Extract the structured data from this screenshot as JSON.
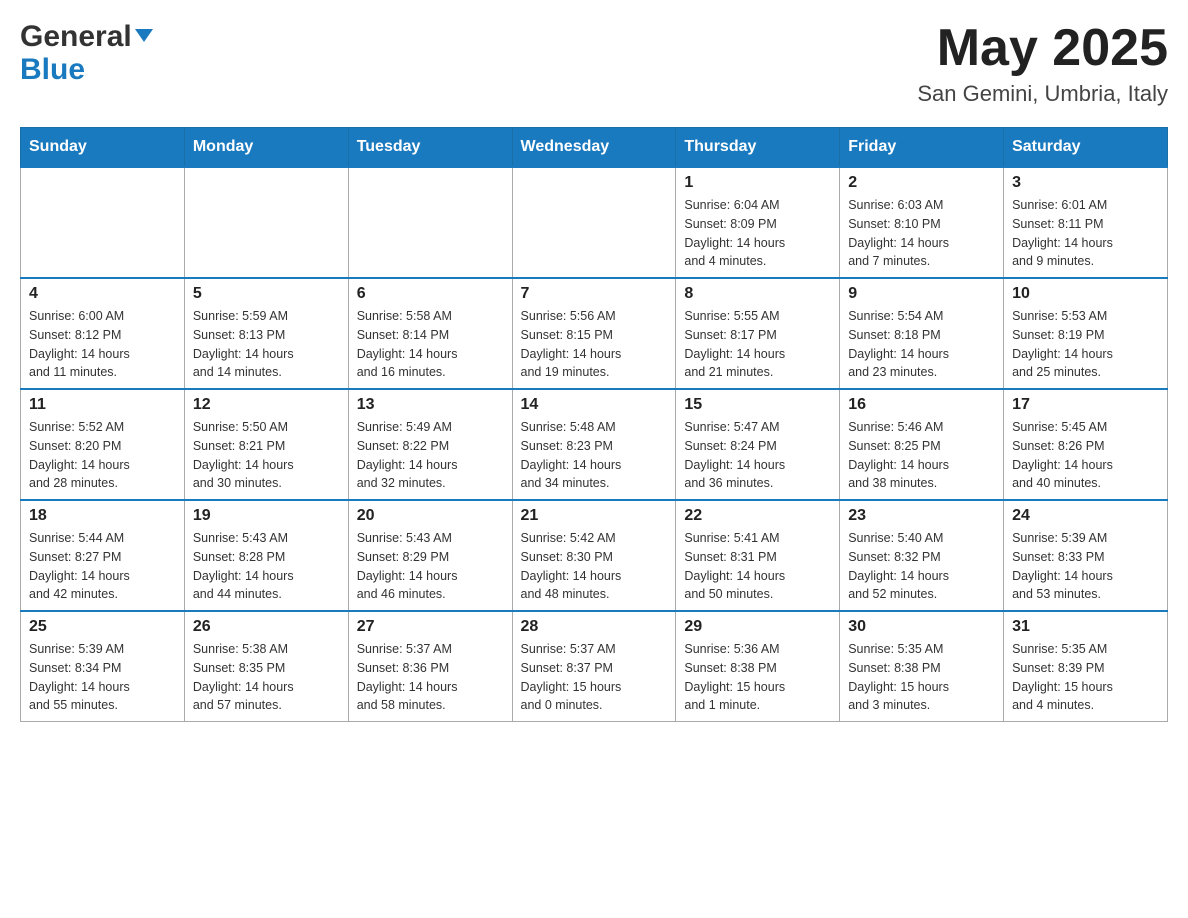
{
  "header": {
    "logo_general": "General",
    "logo_blue": "Blue",
    "month_year": "May 2025",
    "location": "San Gemini, Umbria, Italy"
  },
  "days_of_week": [
    "Sunday",
    "Monday",
    "Tuesday",
    "Wednesday",
    "Thursday",
    "Friday",
    "Saturday"
  ],
  "weeks": [
    [
      {
        "day": "",
        "info": ""
      },
      {
        "day": "",
        "info": ""
      },
      {
        "day": "",
        "info": ""
      },
      {
        "day": "",
        "info": ""
      },
      {
        "day": "1",
        "info": "Sunrise: 6:04 AM\nSunset: 8:09 PM\nDaylight: 14 hours\nand 4 minutes."
      },
      {
        "day": "2",
        "info": "Sunrise: 6:03 AM\nSunset: 8:10 PM\nDaylight: 14 hours\nand 7 minutes."
      },
      {
        "day": "3",
        "info": "Sunrise: 6:01 AM\nSunset: 8:11 PM\nDaylight: 14 hours\nand 9 minutes."
      }
    ],
    [
      {
        "day": "4",
        "info": "Sunrise: 6:00 AM\nSunset: 8:12 PM\nDaylight: 14 hours\nand 11 minutes."
      },
      {
        "day": "5",
        "info": "Sunrise: 5:59 AM\nSunset: 8:13 PM\nDaylight: 14 hours\nand 14 minutes."
      },
      {
        "day": "6",
        "info": "Sunrise: 5:58 AM\nSunset: 8:14 PM\nDaylight: 14 hours\nand 16 minutes."
      },
      {
        "day": "7",
        "info": "Sunrise: 5:56 AM\nSunset: 8:15 PM\nDaylight: 14 hours\nand 19 minutes."
      },
      {
        "day": "8",
        "info": "Sunrise: 5:55 AM\nSunset: 8:17 PM\nDaylight: 14 hours\nand 21 minutes."
      },
      {
        "day": "9",
        "info": "Sunrise: 5:54 AM\nSunset: 8:18 PM\nDaylight: 14 hours\nand 23 minutes."
      },
      {
        "day": "10",
        "info": "Sunrise: 5:53 AM\nSunset: 8:19 PM\nDaylight: 14 hours\nand 25 minutes."
      }
    ],
    [
      {
        "day": "11",
        "info": "Sunrise: 5:52 AM\nSunset: 8:20 PM\nDaylight: 14 hours\nand 28 minutes."
      },
      {
        "day": "12",
        "info": "Sunrise: 5:50 AM\nSunset: 8:21 PM\nDaylight: 14 hours\nand 30 minutes."
      },
      {
        "day": "13",
        "info": "Sunrise: 5:49 AM\nSunset: 8:22 PM\nDaylight: 14 hours\nand 32 minutes."
      },
      {
        "day": "14",
        "info": "Sunrise: 5:48 AM\nSunset: 8:23 PM\nDaylight: 14 hours\nand 34 minutes."
      },
      {
        "day": "15",
        "info": "Sunrise: 5:47 AM\nSunset: 8:24 PM\nDaylight: 14 hours\nand 36 minutes."
      },
      {
        "day": "16",
        "info": "Sunrise: 5:46 AM\nSunset: 8:25 PM\nDaylight: 14 hours\nand 38 minutes."
      },
      {
        "day": "17",
        "info": "Sunrise: 5:45 AM\nSunset: 8:26 PM\nDaylight: 14 hours\nand 40 minutes."
      }
    ],
    [
      {
        "day": "18",
        "info": "Sunrise: 5:44 AM\nSunset: 8:27 PM\nDaylight: 14 hours\nand 42 minutes."
      },
      {
        "day": "19",
        "info": "Sunrise: 5:43 AM\nSunset: 8:28 PM\nDaylight: 14 hours\nand 44 minutes."
      },
      {
        "day": "20",
        "info": "Sunrise: 5:43 AM\nSunset: 8:29 PM\nDaylight: 14 hours\nand 46 minutes."
      },
      {
        "day": "21",
        "info": "Sunrise: 5:42 AM\nSunset: 8:30 PM\nDaylight: 14 hours\nand 48 minutes."
      },
      {
        "day": "22",
        "info": "Sunrise: 5:41 AM\nSunset: 8:31 PM\nDaylight: 14 hours\nand 50 minutes."
      },
      {
        "day": "23",
        "info": "Sunrise: 5:40 AM\nSunset: 8:32 PM\nDaylight: 14 hours\nand 52 minutes."
      },
      {
        "day": "24",
        "info": "Sunrise: 5:39 AM\nSunset: 8:33 PM\nDaylight: 14 hours\nand 53 minutes."
      }
    ],
    [
      {
        "day": "25",
        "info": "Sunrise: 5:39 AM\nSunset: 8:34 PM\nDaylight: 14 hours\nand 55 minutes."
      },
      {
        "day": "26",
        "info": "Sunrise: 5:38 AM\nSunset: 8:35 PM\nDaylight: 14 hours\nand 57 minutes."
      },
      {
        "day": "27",
        "info": "Sunrise: 5:37 AM\nSunset: 8:36 PM\nDaylight: 14 hours\nand 58 minutes."
      },
      {
        "day": "28",
        "info": "Sunrise: 5:37 AM\nSunset: 8:37 PM\nDaylight: 15 hours\nand 0 minutes."
      },
      {
        "day": "29",
        "info": "Sunrise: 5:36 AM\nSunset: 8:38 PM\nDaylight: 15 hours\nand 1 minute."
      },
      {
        "day": "30",
        "info": "Sunrise: 5:35 AM\nSunset: 8:38 PM\nDaylight: 15 hours\nand 3 minutes."
      },
      {
        "day": "31",
        "info": "Sunrise: 5:35 AM\nSunset: 8:39 PM\nDaylight: 15 hours\nand 4 minutes."
      }
    ]
  ]
}
